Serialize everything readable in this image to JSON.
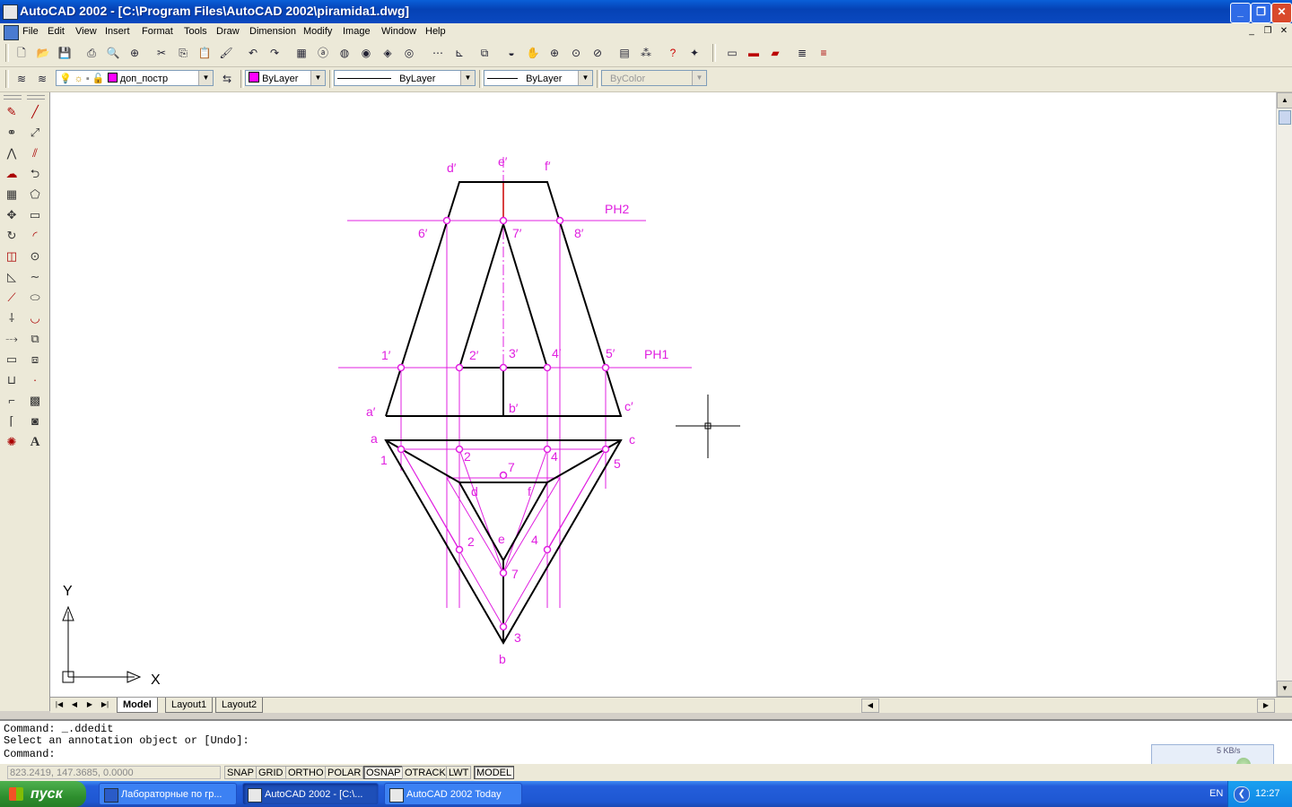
{
  "window": {
    "title": "AutoCAD 2002 - [C:\\Program Files\\AutoCAD 2002\\piramida1.dwg]"
  },
  "menu": [
    "File",
    "Edit",
    "View",
    "Insert",
    "Format",
    "Tools",
    "Draw",
    "Dimension",
    "Modify",
    "Image",
    "Window",
    "Help"
  ],
  "properties_toolbar": {
    "layer": "доп_постр",
    "color": "ByLayer",
    "linetype": "ByLayer",
    "lineweight": "ByLayer",
    "plotstyle": "ByColor",
    "layer_color": "#ff00ff"
  },
  "drawing": {
    "labels_front": {
      "d": "d′",
      "e": "e′",
      "f": "f′",
      "p6": "6′",
      "p7": "7′",
      "p8": "8′",
      "p1": "1′",
      "p2": "2′",
      "p3": "3′",
      "p4": "4′",
      "p5": "5′",
      "a": "a′",
      "b": "b′",
      "c": "c′"
    },
    "plane_labels": {
      "ph2": "PH2",
      "ph1": "PH1"
    },
    "labels_top": {
      "a": "a",
      "c": "c",
      "b": "b",
      "d": "d",
      "f": "f",
      "e": "e",
      "p1": "1",
      "p2": "2",
      "p4": "4",
      "p5": "5",
      "p7": "7",
      "p2b": "2",
      "p4b": "4",
      "p7b": "7",
      "p3": "3"
    },
    "ucs": {
      "x": "X",
      "y": "Y"
    },
    "accent_color": "#e020e0"
  },
  "tabs": [
    "Model",
    "Layout1",
    "Layout2"
  ],
  "active_tab": "Model",
  "command": {
    "line1": "Command: _.ddedit",
    "line2": "Select an annotation object or [Undo]:",
    "line3": "Command:"
  },
  "status": {
    "coords": "823.2419, 147.3685, 0.0000",
    "buttons": [
      "SNAP",
      "GRID",
      "ORTHO",
      "POLAR",
      "OSNAP",
      "OTRACK",
      "LWT",
      "MODEL"
    ],
    "on": [
      "OSNAP",
      "MODEL"
    ]
  },
  "network_widget": {
    "speed": "5 KB/s"
  },
  "taskbar": {
    "start": "пуск",
    "tasks": [
      {
        "label": "Лабораторные по гр..."
      },
      {
        "label": "AutoCAD 2002 - [C:\\..."
      },
      {
        "label": "AutoCAD 2002 Today"
      }
    ],
    "lang": "EN",
    "clock": "12:27"
  }
}
